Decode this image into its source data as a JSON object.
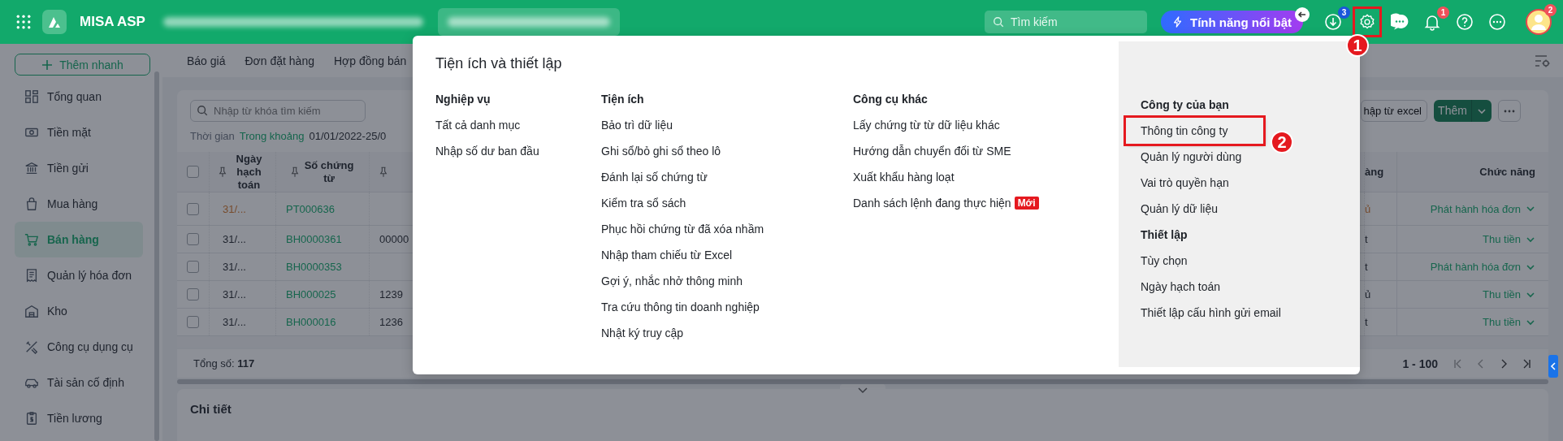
{
  "topbar": {
    "app_name": "MISA ASP",
    "search": {
      "placeholder": "Tìm kiếm"
    },
    "feature_button": "Tính năng nổi bật",
    "download_badge": "3",
    "settings_highlighted": true,
    "notification_badge": "1",
    "avatar_badge": "2"
  },
  "sidebar": {
    "quick_add": "Thêm nhanh",
    "items": [
      {
        "label": "Tổng quan",
        "selected": false
      },
      {
        "label": "Tiền mặt",
        "selected": false
      },
      {
        "label": "Tiền gửi",
        "selected": false
      },
      {
        "label": "Mua hàng",
        "selected": false
      },
      {
        "label": "Bán hàng",
        "selected": true
      },
      {
        "label": "Quản lý hóa đơn",
        "selected": false
      },
      {
        "label": "Kho",
        "selected": false
      },
      {
        "label": "Công cụ dụng cụ",
        "selected": false
      },
      {
        "label": "Tài sản cố định",
        "selected": false
      },
      {
        "label": "Tiền lương",
        "selected": false
      }
    ]
  },
  "tabs": [
    {
      "label": "Báo giá"
    },
    {
      "label": "Đơn đặt hàng"
    },
    {
      "label": "Hợp đồng bán"
    }
  ],
  "filter": {
    "search_placeholder": "Nhập từ khóa tìm kiếm",
    "time_label": "Thời gian",
    "time_mode": "Trong khoảng",
    "date_range": "01/01/2022-25/0"
  },
  "actions": {
    "import_button": "hập từ excel",
    "add_button": "Thêm"
  },
  "table": {
    "header_checked": false,
    "headers": {
      "date": "Ngày hạch toán",
      "voucher": "Số chứng từ",
      "column_4": "àng",
      "function": "Chức năng"
    },
    "rows": [
      {
        "checked": false,
        "date": "31/...",
        "voucher": "PT000636",
        "column_4": "ủ",
        "action": "Phát hành hóa đơn",
        "warning": true
      },
      {
        "checked": false,
        "date": "31/...",
        "voucher": "BH0000361",
        "column_3": "00000",
        "column_4": "t",
        "action": "Thu tiền",
        "warning": false
      },
      {
        "checked": false,
        "date": "31/...",
        "voucher": "BH0000353",
        "column_4": "t",
        "action": "Phát hành hóa đơn",
        "warning": false
      },
      {
        "checked": false,
        "date": "31/...",
        "voucher": "BH000025",
        "column_3": "1239",
        "column_4": "ủ",
        "action": "Thu tiền",
        "warning": false
      },
      {
        "checked": false,
        "date": "31/...",
        "voucher": "BH000016",
        "column_3": "1236",
        "column_4": "t",
        "action": "Thu tiền",
        "warning": false
      }
    ]
  },
  "footer": {
    "total_label": "Tổng số:",
    "total": "117",
    "page_range": "1 - 100"
  },
  "detail_panel": {
    "title": "Chi tiết"
  },
  "settings_menu": {
    "title": "Tiện ích và thiết lập",
    "columns": [
      {
        "heading": "Nghiệp vụ",
        "items": [
          {
            "label": "Tất cả danh mục"
          },
          {
            "label": "Nhập số dư ban đầu"
          }
        ]
      },
      {
        "heading": "Tiện ích",
        "items": [
          {
            "label": "Bảo trì dữ liệu"
          },
          {
            "label": "Ghi sổ/bỏ ghi sổ theo lô"
          },
          {
            "label": "Đánh lại số chứng từ"
          },
          {
            "label": "Kiểm tra sổ sách"
          },
          {
            "label": "Phục hồi chứng từ đã xóa nhầm"
          },
          {
            "label": "Nhập tham chiếu từ Excel"
          },
          {
            "label": "Gợi ý, nhắc nhở thông minh"
          },
          {
            "label": "Tra cứu thông tin doanh nghiệp"
          },
          {
            "label": "Nhật ký truy cập"
          }
        ]
      },
      {
        "heading": "Công cụ khác",
        "items": [
          {
            "label": "Lấy chứng từ từ dữ liệu khác"
          },
          {
            "label": "Hướng dẫn chuyển đổi từ SME"
          },
          {
            "label": "Xuất khẩu hàng loạt"
          },
          {
            "label": "Danh sách lệnh đang thực hiện",
            "badge": "Mới"
          }
        ]
      }
    ],
    "side_sections": [
      {
        "heading": "Công ty của bạn",
        "items": [
          {
            "label": "Thông tin công ty",
            "highlighted": true
          },
          {
            "label": "Quản lý người dùng",
            "highlighted": false
          },
          {
            "label": "Vai trò quyền hạn",
            "highlighted": false
          },
          {
            "label": "Quản lý dữ liệu",
            "highlighted": false
          }
        ]
      },
      {
        "heading": "Thiết lập",
        "items": [
          {
            "label": "Tùy chọn",
            "highlighted": false
          },
          {
            "label": "Ngày hạch toán",
            "highlighted": false
          },
          {
            "label": "Thiết lập cấu hình gửi email",
            "highlighted": false
          }
        ]
      }
    ]
  },
  "callouts": [
    {
      "number": "1"
    },
    {
      "number": "2"
    }
  ]
}
